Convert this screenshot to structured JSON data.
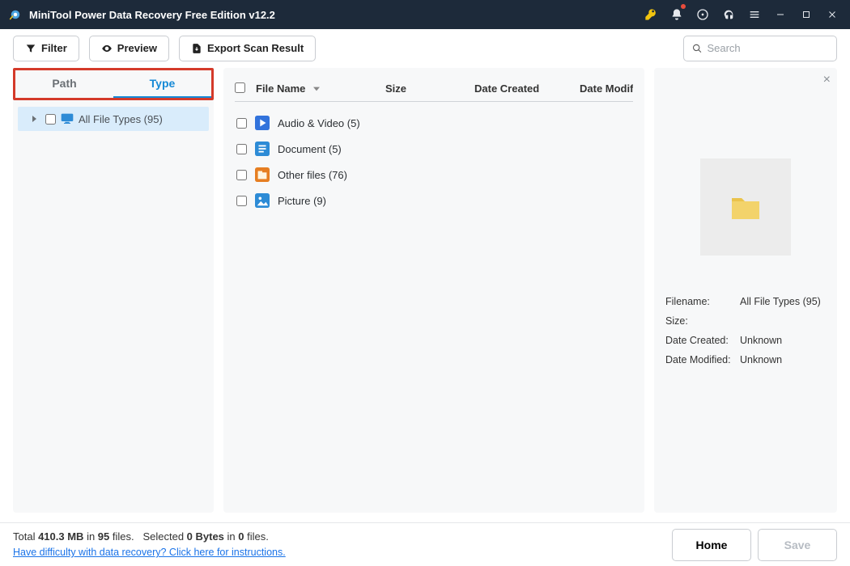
{
  "titlebar": {
    "title": "MiniTool Power Data Recovery Free Edition v12.2"
  },
  "toolbar": {
    "filter_label": "Filter",
    "preview_label": "Preview",
    "export_label": "Export Scan Result",
    "search_placeholder": "Search"
  },
  "tabs": {
    "path": "Path",
    "type": "Type"
  },
  "tree": {
    "root": "All File Types (95)"
  },
  "columns": {
    "name": "File Name",
    "size": "Size",
    "created": "Date Created",
    "modified": "Date Modifie"
  },
  "files": [
    {
      "icon": "av",
      "label": "Audio & Video (5)"
    },
    {
      "icon": "doc",
      "label": "Document (5)"
    },
    {
      "icon": "other",
      "label": "Other files (76)"
    },
    {
      "icon": "pic",
      "label": "Picture (9)"
    }
  ],
  "preview": {
    "filename_label": "Filename:",
    "filename_val": "All File Types (95)",
    "size_label": "Size:",
    "size_val": "",
    "created_label": "Date Created:",
    "created_val": "Unknown",
    "modified_label": "Date Modified:",
    "modified_val": "Unknown"
  },
  "footer": {
    "total_pre": "Total ",
    "total_mb": "410.3 MB",
    "total_mid": " in ",
    "total_files": "95",
    "total_post": " files.",
    "selected_pre": "Selected ",
    "selected_bytes": "0 Bytes",
    "selected_mid": " in ",
    "selected_files": "0",
    "selected_post": " files.",
    "help_link": "Have difficulty with data recovery? Click here for instructions.",
    "home": "Home",
    "save": "Save"
  }
}
